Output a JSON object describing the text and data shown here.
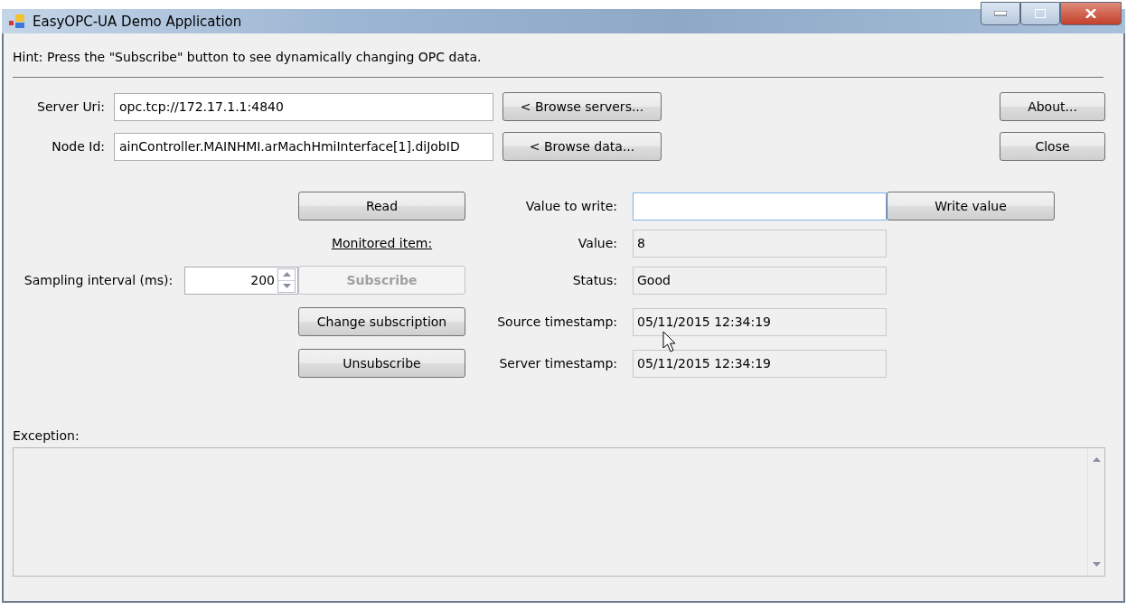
{
  "window": {
    "title": "EasyOPC-UA Demo Application"
  },
  "hint": "Hint: Press the \"Subscribe\" button to see dynamically changing OPC data.",
  "connection": [
    {
      "label": "Server Uri:",
      "value": "opc.tcp://172.17.1.1:4840",
      "button": "< Browse servers..."
    },
    {
      "label": "Node Id:",
      "value": "ainController.MAINHMI.arMachHmiInterface[1].diJobID",
      "button": "< Browse data..."
    }
  ],
  "side_buttons": [
    {
      "label": "About..."
    },
    {
      "label": "Close"
    }
  ],
  "read_button": {
    "label": "Read",
    "disabled": false
  },
  "write": {
    "label": "Value to write:",
    "focused": true,
    "button": "Write value"
  },
  "monitored_item_label": "Monitored item:",
  "sampling": {
    "label": "Sampling interval (ms):",
    "value": "200"
  },
  "subscription_buttons": [
    {
      "label": "Subscribe",
      "disabled": true
    },
    {
      "label": "Change subscription",
      "disabled": false
    },
    {
      "label": "Unsubscribe",
      "disabled": false
    }
  ],
  "readouts": [
    {
      "label": "Value:",
      "value": "8"
    },
    {
      "label": "Status:",
      "value": "Good"
    },
    {
      "label": "Source timestamp:",
      "value": "05/11/2015 12:34:19"
    },
    {
      "label": "Server timestamp:",
      "value": "05/11/2015 12:34:19"
    }
  ],
  "exception": {
    "label": "Exception:"
  }
}
